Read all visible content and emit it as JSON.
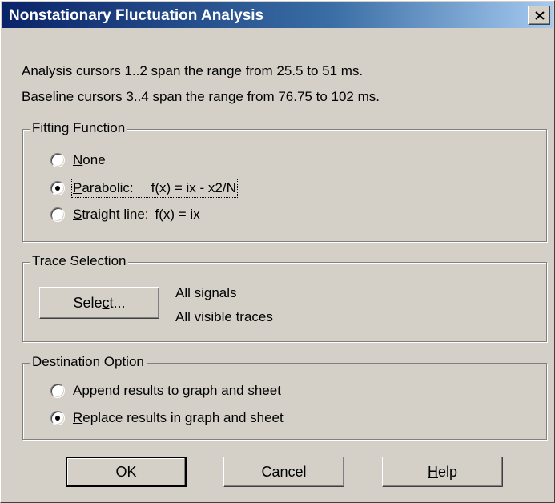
{
  "window": {
    "title": "Nonstationary Fluctuation Analysis",
    "close_label": "✕"
  },
  "info": {
    "line1": "Analysis cursors 1..2 span the range from 25.5 to 51 ms.",
    "line2": "Baseline cursors 3..4 span the range from 76.75 to 102 ms."
  },
  "fitting": {
    "legend": "Fitting Function",
    "options": [
      {
        "accel": "N",
        "rest": "one",
        "formula": "",
        "selected": false
      },
      {
        "accel": "P",
        "rest": "arabolic:",
        "formula": "f(x) = ix - x2/N",
        "selected": true
      },
      {
        "accel": "S",
        "rest": "traight line:",
        "formula": "f(x) = ix",
        "selected": false
      }
    ]
  },
  "trace": {
    "legend": "Trace Selection",
    "select_pre": "Sele",
    "select_accel": "c",
    "select_post": "t...",
    "signals": "All signals",
    "traces": "All visible traces"
  },
  "destination": {
    "legend": "Destination Option",
    "options": [
      {
        "accel": "A",
        "rest": "ppend results to graph and sheet",
        "selected": false
      },
      {
        "accel": "R",
        "rest": "eplace results in graph and sheet",
        "selected": true
      }
    ]
  },
  "buttons": {
    "ok": "OK",
    "cancel": "Cancel",
    "help_accel": "H",
    "help_rest": "elp"
  }
}
